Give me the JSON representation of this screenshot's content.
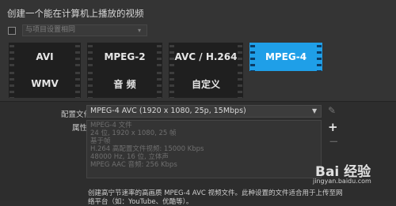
{
  "header": {
    "title": "创建一个能在计算机上播放的视频",
    "same_as_project": {
      "checked": false,
      "label": "与项目设置相同"
    }
  },
  "formats": {
    "row1": [
      {
        "label": "AVI",
        "selected": false
      },
      {
        "label": "MPEG-2",
        "selected": false
      },
      {
        "label": "AVC / H.264",
        "selected": false
      },
      {
        "label": "MPEG-4",
        "selected": true
      }
    ],
    "row2": [
      {
        "label": "WMV",
        "selected": false
      },
      {
        "label": "音 频",
        "selected": false
      },
      {
        "label": "自定义",
        "selected": false
      }
    ],
    "accent": "#1f9fe8"
  },
  "profile": {
    "label": "配置文件:",
    "value": "MPEG-4 AVC (1920 x 1080, 25p, 15Mbps)"
  },
  "attributes": {
    "label": "属性:",
    "lines": [
      "MPEG-4 文件",
      "24 位, 1920 x 1080, 25 帧",
      "基于帧",
      "H.264 高配置文件视频: 15000 Kbps",
      "48000 Hz, 16 位, 立体声",
      "MPEG AAC 音频: 256 Kbps"
    ]
  },
  "description": {
    "line1": "创建高宁节速率的高画质 MPEG-4 AVC 视频文件。此种设置的文件适合用于上传至网",
    "line2": "络平台（如：YouTube、优酷等）。"
  },
  "watermark": {
    "logo": "Bai 经验",
    "url": "jingyan.baidu.com"
  }
}
